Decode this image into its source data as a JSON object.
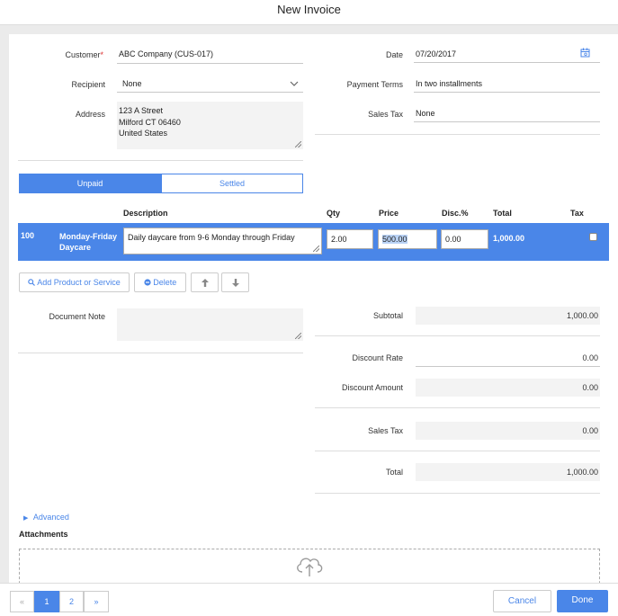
{
  "window": {
    "title": "New Invoice"
  },
  "form": {
    "customer_label": "Customer",
    "customer_required": "*",
    "customer_value": "ABC Company (CUS-017)",
    "recipient_label": "Recipient",
    "recipient_value": "None",
    "address_label": "Address",
    "address_line1": "123 A Street",
    "address_line2": "Milford  CT 06460",
    "address_line3": "United States",
    "date_label": "Date",
    "date_value": "07/20/2017",
    "payment_terms_label": "Payment Terms",
    "payment_terms_value": "In two installments",
    "sales_tax_label": "Sales Tax",
    "sales_tax_value": "None"
  },
  "status_tabs": {
    "unpaid": "Unpaid",
    "settled": "Settled"
  },
  "table": {
    "headers": {
      "description": "Description",
      "qty": "Qty",
      "price": "Price",
      "disc": "Disc.%",
      "total": "Total",
      "tax": "Tax"
    },
    "row": {
      "code": "100",
      "name_line1": "Monday-Friday",
      "name_line2": "Daycare",
      "description": "Daily daycare from 9-6 Monday through Friday",
      "qty": "2.00",
      "price": "500.00",
      "disc": "0.00",
      "total": "1,000.00"
    }
  },
  "actions": {
    "add_product": "Add Product or Service",
    "delete": "Delete"
  },
  "document_note_label": "Document Note",
  "summary": {
    "subtotal_label": "Subtotal",
    "subtotal_value": "1,000.00",
    "discount_rate_label": "Discount Rate",
    "discount_rate_value": "0.00",
    "discount_amount_label": "Discount Amount",
    "discount_amount_value": "0.00",
    "sales_tax_label": "Sales Tax",
    "sales_tax_value": "0.00",
    "total_label": "Total",
    "total_value": "1,000.00"
  },
  "advanced_label": "Advanced",
  "attachments_label": "Attachments",
  "pagination": {
    "prev": "«",
    "page1": "1",
    "page2": "2",
    "next": "»"
  },
  "footer": {
    "cancel": "Cancel",
    "done": "Done"
  },
  "colors": {
    "accent": "#4a86e8",
    "required": "#dd3333"
  }
}
